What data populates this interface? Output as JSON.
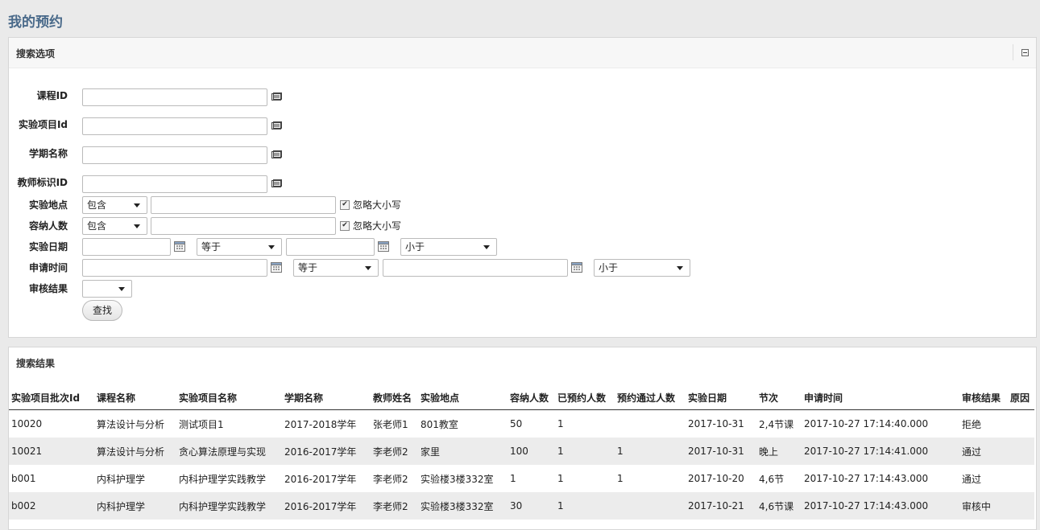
{
  "page_title": "我的预约",
  "search_panel": {
    "title": "搜索选项",
    "fields": {
      "course_id": {
        "label": "课程ID",
        "value": ""
      },
      "project_id": {
        "label": "实验项目Id",
        "value": ""
      },
      "semester": {
        "label": "学期名称",
        "value": ""
      },
      "teacher_id": {
        "label": "教师标识ID",
        "value": ""
      },
      "location": {
        "label": "实验地点",
        "operator": "包含",
        "value": "",
        "ignore_case_label": "忽略大小写",
        "ignore_case": true
      },
      "capacity": {
        "label": "容纳人数",
        "operator": "包含",
        "value": "",
        "ignore_case_label": "忽略大小写",
        "ignore_case": true
      },
      "exp_date": {
        "label": "实验日期",
        "from_value": "",
        "op1": "等于",
        "to_value": "",
        "op2": "小于"
      },
      "apply_time": {
        "label": "申请时间",
        "from_value": "",
        "op1": "等于",
        "to_value": "",
        "op2": "小于"
      },
      "audit_result": {
        "label": "审核结果",
        "value": ""
      }
    },
    "search_button": "查找"
  },
  "results_panel": {
    "title": "搜索结果",
    "columns": [
      "实验项目批次Id",
      "课程名称",
      "实验项目名称",
      "学期名称",
      "教师姓名",
      "实验地点",
      "容纳人数",
      "已预约人数",
      "预约通过人数",
      "实验日期",
      "节次",
      "申请时间",
      "审核结果",
      "原因"
    ],
    "rows": [
      [
        "10020",
        "算法设计与分析",
        "测试项目1",
        "2017-2018学年",
        "张老师1",
        "801教室",
        "50",
        "1",
        "",
        "2017-10-31",
        "2,4节课",
        "2017-10-27 17:14:40.000",
        "拒绝",
        ""
      ],
      [
        "10021",
        "算法设计与分析",
        "贪心算法原理与实现",
        "2016-2017学年",
        "李老师2",
        "家里",
        "100",
        "1",
        "1",
        "2017-10-31",
        "晚上",
        "2017-10-27 17:14:41.000",
        "通过",
        ""
      ],
      [
        "b001",
        "内科护理学",
        "内科护理学实践教学",
        "2016-2017学年",
        "李老师2",
        "实验楼3楼332室",
        "1",
        "1",
        "1",
        "2017-10-20",
        "4,6节",
        "2017-10-27 17:14:43.000",
        "通过",
        ""
      ],
      [
        "b002",
        "内科护理学",
        "内科护理学实践教学",
        "2016-2017学年",
        "李老师2",
        "实验楼3楼332室",
        "30",
        "1",
        "",
        "2017-10-21",
        "4,6节课",
        "2017-10-27 17:14:43.000",
        "审核中",
        ""
      ]
    ]
  }
}
